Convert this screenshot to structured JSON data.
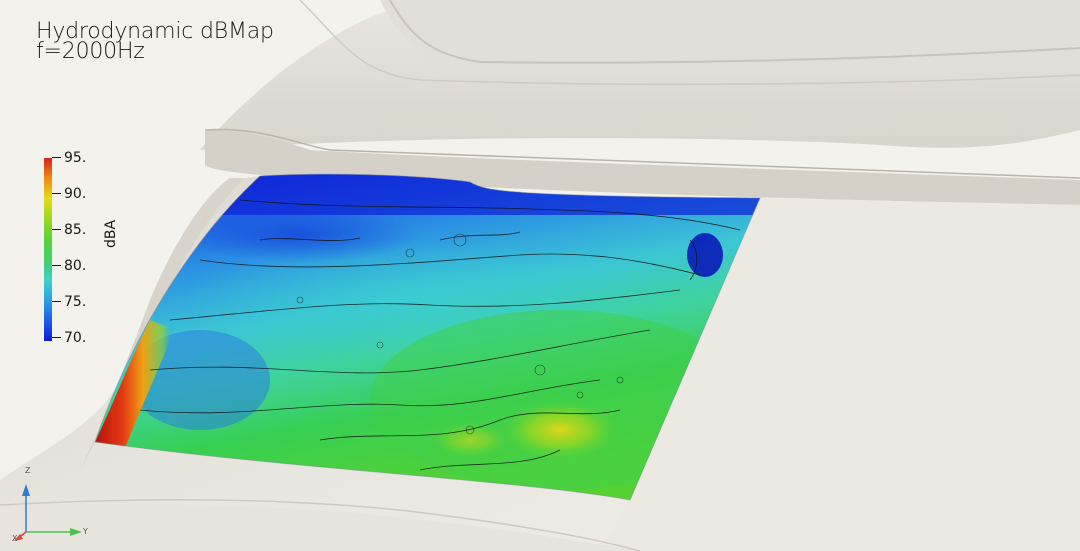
{
  "title": {
    "line1": "Hydrodynamic dBMap",
    "line2": "f=2000Hz"
  },
  "legend": {
    "title": "dBA",
    "ticks": [
      "95.",
      "90.",
      "85.",
      "80.",
      "75.",
      "70."
    ],
    "range": [
      70,
      95
    ],
    "colormap": [
      "#0a1ed8",
      "#1f5be6",
      "#2aa3e6",
      "#3ed1c9",
      "#3fd067",
      "#5bd33a",
      "#9ad81e",
      "#e4dd16",
      "#f08a12",
      "#d8221a"
    ]
  },
  "orientation_axes": {
    "z_label": "Z",
    "y_label": "Y",
    "x_label": "X",
    "z_color": "#2e7bd6",
    "y_color": "#4ec24e",
    "x_color": "#d94444"
  }
}
